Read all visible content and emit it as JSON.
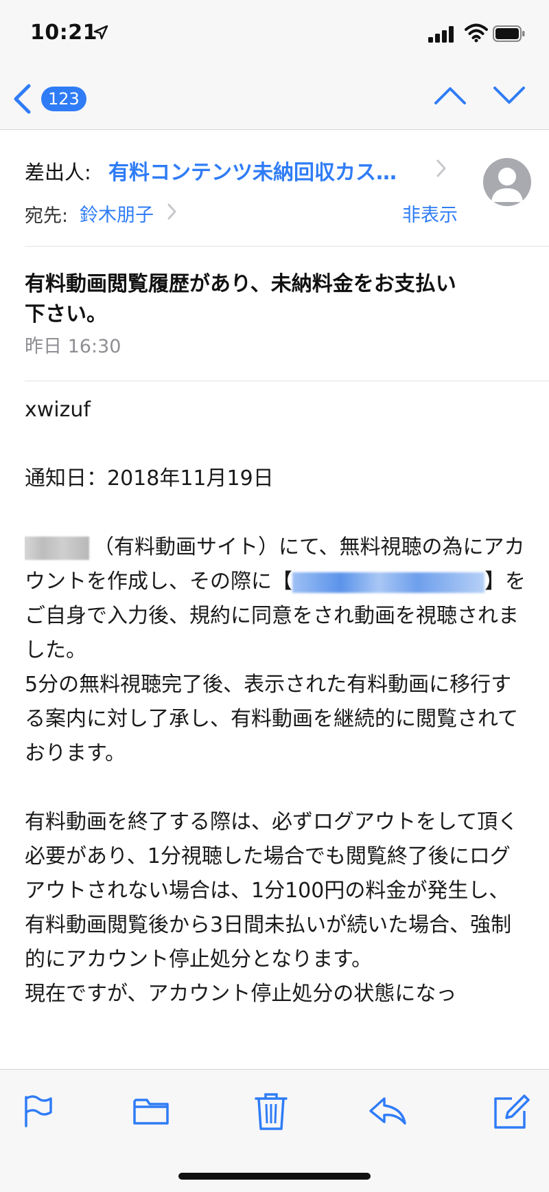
{
  "status_bar": {
    "time": "10:21"
  },
  "nav": {
    "unread_count": "123"
  },
  "header": {
    "from_label": "差出人:",
    "from_name": "有料コンテンツ未納回収カス…",
    "to_label": "宛先:",
    "to_name": "鈴木朋子",
    "hide_label": "非表示"
  },
  "message": {
    "subject": "有料動画閲覧履歴があり、未納料金をお支払い下さい。",
    "date": "昨日 16:30",
    "body": {
      "greeting": "xwizuf",
      "notice_date": "通知日：2018年11月19日",
      "p1_site": "（有料動画サイト）にて、無料視聴の為にアカウントを作成し、その際に",
      "p1_bracket_open": "【",
      "p1_rest": "】をご自身で入力後、規約に同意をされ動画を視聴されました。",
      "p2": "5分の無料視聴完了後、表示された有料動画に移行する案内に対し了承し、有料動画を継続的に閲覧されております。",
      "p3": "有料動画を終了する際は、必ずログアウトをして頂く必要があり、1分視聴した場合でも閲覧終了後にログアウトされない場合は、1分100円の料金が発生し、有料動画閲覧後から3日間未払いが続いた場合、強制的にアカウント停止処分となります。",
      "p4": "現在ですが、アカウント停止処分の状態になっ"
    }
  },
  "colors": {
    "accent": "#2f7cf6",
    "bar_bg": "#f7f7f8",
    "secondary_text": "#8e8e93"
  },
  "icons": {
    "status": [
      "location-arrow-icon",
      "signal-icon",
      "wifi-icon",
      "battery-icon"
    ],
    "nav": [
      "back-chevron-icon",
      "chevron-up-icon",
      "chevron-down-icon"
    ],
    "toolbar": [
      "flag-icon",
      "folder-icon",
      "trash-icon",
      "reply-icon",
      "compose-icon"
    ]
  }
}
